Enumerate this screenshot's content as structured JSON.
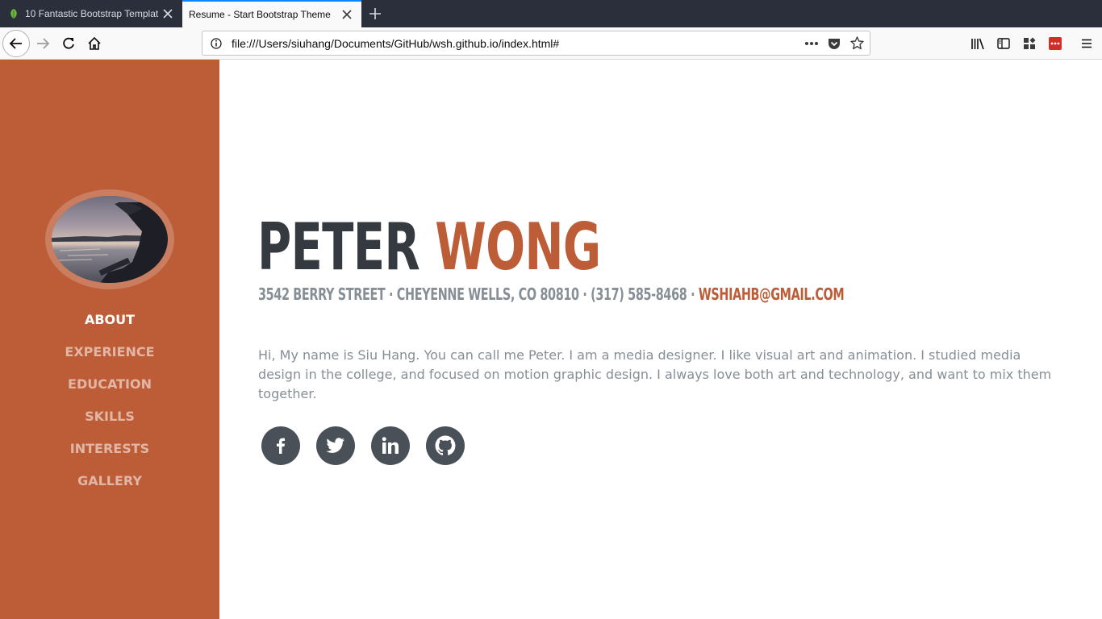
{
  "browser": {
    "tabs": [
      {
        "title": "10 Fantastic Bootstrap Templat",
        "active": false,
        "icon": "leaf-icon"
      },
      {
        "title": "Resume - Start Bootstrap Theme",
        "active": true,
        "icon": "none"
      }
    ],
    "url": "file:///Users/siuhang/Documents/GitHub/wsh.github.io/index.html#",
    "accent": "#0a84ff"
  },
  "sidebar": {
    "background": "#bd5d38",
    "nav": [
      {
        "label": "ABOUT",
        "active": true
      },
      {
        "label": "EXPERIENCE",
        "active": false
      },
      {
        "label": "EDUCATION",
        "active": false
      },
      {
        "label": "SKILLS",
        "active": false
      },
      {
        "label": "INTERESTS",
        "active": false
      },
      {
        "label": "GALLERY",
        "active": false
      }
    ]
  },
  "about": {
    "first_name": "PETER",
    "last_name": "WONG",
    "address": "3542 BERRY STREET · CHEYENNE WELLS, CO 80810 · (317) 585-8468 ·",
    "email": "WSHIAHB@GMAIL.COM",
    "bio": "Hi, My name is Siu Hang. You can call me Peter. I am a media designer. I like visual art and animation. I studied media design in the college, and focused on motion graphic design. I always love both art and technology, and want to mix them together.",
    "social": [
      "facebook-icon",
      "twitter-icon",
      "linkedin-icon",
      "github-icon"
    ]
  },
  "colors": {
    "primary": "#bd5d38",
    "heading": "#343a40",
    "muted": "#868e96",
    "social": "#495057"
  }
}
